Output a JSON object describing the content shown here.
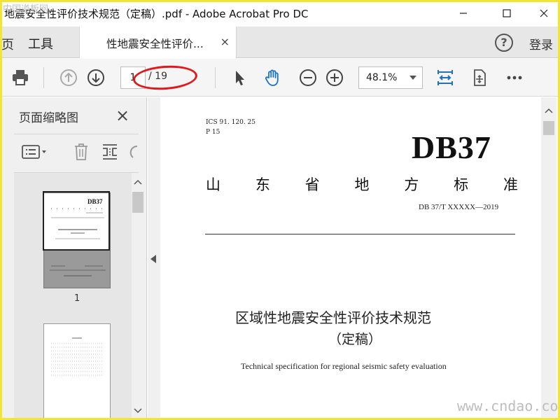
{
  "window": {
    "title": "地震安全性评价技术规范（定稿）.pdf - Adobe Acrobat Pro DC",
    "minimize_icon": "minimize-icon",
    "maximize_icon": "maximize-icon",
    "close_icon": "close-icon"
  },
  "tabs": {
    "home_label": "页",
    "tools_label": "工具",
    "document_label": "性地震安全性评价...",
    "document_close": "×",
    "help_label": "?",
    "login_label": "登录"
  },
  "toolbar": {
    "print_icon": "print-icon",
    "prev_page_icon": "arrow-up-circle-icon",
    "next_page_icon": "arrow-down-circle-icon",
    "current_page": "1",
    "page_total": "/ 19",
    "select_icon": "cursor-arrow-icon",
    "hand_icon": "hand-icon",
    "zoom_out_icon": "zoom-out-icon",
    "zoom_in_icon": "zoom-in-icon",
    "zoom_value": "48.1%",
    "fit_width_icon": "fit-width-icon",
    "rotate_icon": "rotate-page-icon",
    "more_icon": "more-icon"
  },
  "left_panel": {
    "title": "页面缩略图",
    "close": "×",
    "options_icon": "options-icon",
    "delete_icon": "trash-icon",
    "insert_icon": "insert-pages-icon",
    "rotate_icon": "rotate-icon",
    "thumbnail_1_label": "1",
    "thumbnail_1_title": "DB37"
  },
  "document": {
    "ics": "ICS   91. 120. 25",
    "p": "P  15",
    "db_code": "DB37",
    "standard_chars": [
      "山",
      "东",
      "省",
      "地",
      "方",
      "标",
      "准"
    ],
    "standard_number": "DB 37/T  XXXXX—2019",
    "title_cn": "区域性地震安全性评价技术规范",
    "subtitle_cn": "（定稿）",
    "title_en": "Technical specification for regional seismic safety evaluation"
  },
  "watermarks": {
    "top_left": "中国道板网",
    "bottom_right": "www.cndao.com"
  },
  "colors": {
    "accent_blue": "#1a73c7",
    "annotation_red": "#e01a1a",
    "frame_yellow": "#f3e533"
  }
}
